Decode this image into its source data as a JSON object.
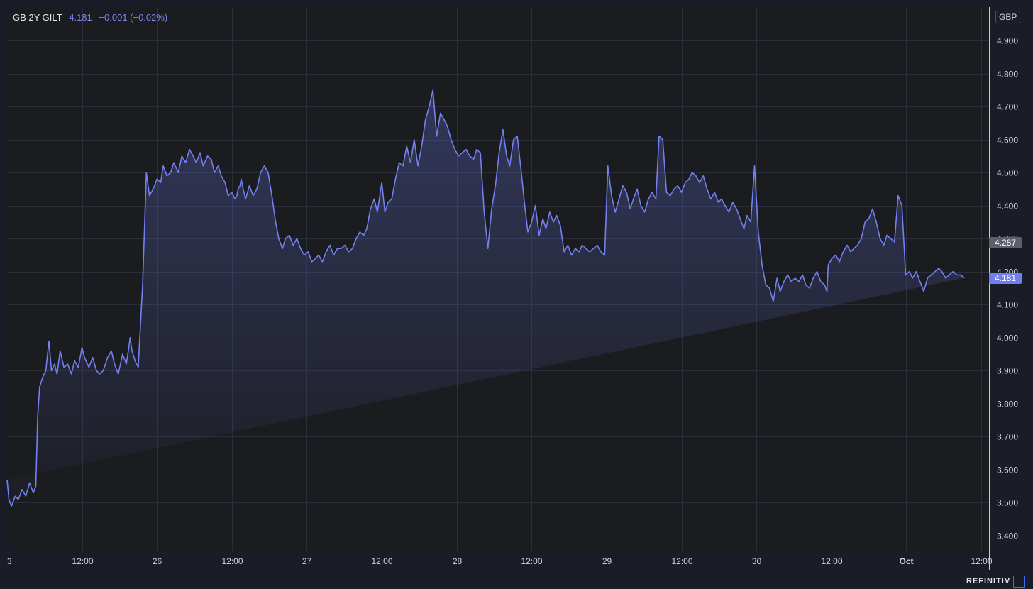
{
  "legend": {
    "symbol": "GB 2Y GILT",
    "last": "4.181",
    "change": "−0.001 (−0.02%)"
  },
  "currency": "GBP",
  "last_price_tag": "4.181",
  "prev_close_tag": "4.287",
  "brand": "REFINITIV",
  "colors": {
    "background": "#1a1d27",
    "plot_background": "#1b1c20",
    "line": "#7380f0",
    "grid": "#2a2e39",
    "axis_text": "#d1d4dc",
    "last_tag": "#6f7ef0",
    "prev_tag": "#5d606b"
  },
  "chart_data": {
    "type": "area",
    "title": "GB 2Y GILT",
    "xlabel": "",
    "ylabel": "",
    "ylim": [
      3.35,
      4.98
    ],
    "yticks": [
      3.4,
      3.5,
      3.6,
      3.7,
      3.8,
      3.9,
      4.0,
      4.1,
      4.2,
      4.3,
      4.4,
      4.5,
      4.6,
      4.7,
      4.8,
      4.9
    ],
    "ytick_labels": [
      "3.400",
      "3.500",
      "3.600",
      "3.700",
      "3.800",
      "3.900",
      "4.000",
      "4.100",
      "4.200",
      "4.300",
      "4.400",
      "4.500",
      "4.600",
      "4.700",
      "4.800",
      "4.900"
    ],
    "xlim": [
      0,
      132
    ],
    "xticks": [
      0,
      12,
      24,
      36,
      48,
      60,
      72,
      84,
      96,
      108,
      120,
      132
    ],
    "xtick_labels": [
      "3",
      "12:00",
      "26",
      "12:00",
      "27",
      "12:00",
      "28",
      "12:00",
      "29",
      "12:00",
      "30",
      "12:00",
      "Oct",
      "12:00"
    ],
    "xtick_hours": [
      0,
      12,
      24,
      36,
      48,
      60,
      72,
      84,
      96,
      108,
      120,
      132,
      144,
      156
    ],
    "x_hours_offset": -11.2,
    "grid": true,
    "legend_position": "top-left",
    "series": [
      {
        "name": "GB 2Y GILT",
        "hours": [
          -11.2,
          -10.9,
          -10.5,
          -9.9,
          -9.4,
          -8.8,
          -8.2,
          -7.6,
          -7.0,
          -6.6,
          -6.3,
          -6.0,
          -5.5,
          -5.0,
          -4.5,
          -4.1,
          -3.6,
          -3.2,
          -2.7,
          -2.1,
          -1.5,
          -0.9,
          -0.4,
          0.2,
          0.8,
          1.2,
          1.9,
          2.5,
          3.1,
          3.6,
          4.2,
          4.9,
          5.5,
          6.0,
          6.6,
          7.3,
          7.9,
          8.3,
          8.5,
          8.8,
          9.3,
          9.8,
          10.5,
          11.1,
          11.6,
          12.2,
          12.8,
          13.4,
          13.8,
          14.4,
          15.0,
          15.5,
          16.2,
          16.8,
          17.4,
          18.0,
          18.6,
          19.1,
          19.7,
          20.2,
          20.9,
          21.5,
          22.0,
          22.6,
          23.1,
          23.7,
          24.2,
          24.8,
          25.3,
          25.6,
          25.8,
          26.1,
          26.3,
          26.6,
          27.0,
          27.6,
          28.2,
          28.8,
          29.4,
          30.0,
          30.6,
          31.2,
          31.8,
          32.3,
          32.9,
          33.4,
          34.0,
          34.6,
          35.2,
          35.8,
          36.4,
          37.0,
          37.6,
          38.2,
          38.7,
          39.3,
          39.9,
          40.5,
          41.1,
          41.7,
          42.3,
          42.9,
          43.5,
          44.1,
          44.7,
          45.3,
          45.9,
          46.4,
          47.0,
          47.6,
          48.1,
          48.8,
          49.3,
          49.8,
          50.4,
          51.0,
          51.6,
          52.2,
          52.8,
          53.4,
          54.0,
          54.6,
          55.2,
          55.8,
          56.4,
          57.0,
          57.6,
          58.2,
          58.8,
          59.3,
          59.9,
          60.5,
          61.1,
          61.7,
          62.3,
          62.9,
          63.5,
          64.0,
          64.6,
          65.2,
          65.8,
          66.4,
          67.0,
          67.6,
          68.2,
          68.8,
          69.3,
          69.9,
          70.5,
          71.1,
          71.7,
          72.2,
          72.8,
          73.4,
          74.0,
          74.6,
          75.1,
          75.7,
          76.3,
          76.8,
          77.4,
          78.0,
          78.6,
          79.2,
          79.8,
          80.4,
          80.9,
          81.5,
          82.1,
          82.7,
          83.3,
          83.9,
          84.5,
          85.0,
          85.6,
          86.2,
          86.8,
          87.4,
          88.0,
          88.6,
          89.1,
          89.7,
          90.3,
          90.9,
          91.5,
          92.1,
          92.7,
          93.2,
          93.8,
          94.4,
          95.0,
          95.6,
          96.2,
          96.8,
          97.4,
          98.0,
          98.5,
          99.1,
          99.7,
          100.3,
          100.9,
          101.5,
          102.1,
          102.7,
          103.2,
          103.8,
          104.4,
          105.0,
          105.6,
          106.2,
          106.8,
          107.3,
          107.9,
          108.5,
          109.1,
          109.7,
          110.3,
          110.9,
          111.5,
          112.1,
          112.6,
          113.2,
          113.8,
          114.4,
          115.0,
          115.6,
          116.2,
          116.7,
          117.3,
          117.9,
          118.5,
          119.1,
          119.7,
          120.1,
          120.3,
          120.9,
          121.5,
          122.1,
          122.7,
          123.3,
          123.9,
          124.4,
          125.0,
          125.6,
          126.2,
          126.8,
          127.4,
          128.0,
          128.6,
          129.2,
          129.7,
          130.3,
          130.9,
          131.5,
          132.1,
          132.7,
          133.3,
          133.8,
          134.4,
          135.0,
          135.6,
          136.2,
          136.8,
          137.4,
          138.0,
          138.5,
          139.1,
          139.7,
          140.3,
          140.9,
          141.5,
          142.1,
          142.7,
          143.2,
          143.8,
          144.4,
          145.0,
          145.3,
          145.6,
          146.0,
          146.6,
          147.2,
          147.8,
          148.4,
          149.0,
          149.6,
          150.2,
          150.7,
          151.2
        ],
        "values": [
          3.57,
          3.51,
          3.49,
          3.52,
          3.51,
          3.54,
          3.52,
          3.56,
          3.53,
          3.55,
          3.76,
          3.85,
          3.88,
          3.9,
          3.99,
          3.9,
          3.92,
          3.89,
          3.96,
          3.91,
          3.92,
          3.89,
          3.93,
          3.91,
          3.97,
          3.94,
          3.91,
          3.94,
          3.9,
          3.89,
          3.9,
          3.94,
          3.96,
          3.92,
          3.89,
          3.95,
          3.92,
          3.97,
          4.0,
          3.96,
          3.93,
          3.91,
          4.16,
          4.5,
          4.43,
          4.45,
          4.48,
          4.47,
          4.52,
          4.49,
          4.5,
          4.53,
          4.5,
          4.55,
          4.53,
          4.57,
          4.55,
          4.53,
          4.56,
          4.52,
          4.55,
          4.54,
          4.5,
          4.52,
          4.49,
          4.47,
          4.43,
          4.44,
          4.42,
          4.43,
          4.45,
          4.46,
          4.48,
          4.45,
          4.42,
          4.46,
          4.43,
          4.45,
          4.5,
          4.52,
          4.5,
          4.43,
          4.35,
          4.3,
          4.27,
          4.3,
          4.31,
          4.28,
          4.3,
          4.27,
          4.25,
          4.26,
          4.23,
          4.24,
          4.25,
          4.23,
          4.26,
          4.28,
          4.25,
          4.27,
          4.27,
          4.28,
          4.26,
          4.27,
          4.3,
          4.32,
          4.31,
          4.33,
          4.39,
          4.42,
          4.38,
          4.47,
          4.38,
          4.41,
          4.42,
          4.48,
          4.53,
          4.52,
          4.58,
          4.53,
          4.6,
          4.52,
          4.58,
          4.66,
          4.7,
          4.75,
          4.61,
          4.68,
          4.66,
          4.64,
          4.6,
          4.57,
          4.55,
          4.56,
          4.57,
          4.55,
          4.54,
          4.57,
          4.56,
          4.38,
          4.27,
          4.39,
          4.46,
          4.56,
          4.63,
          4.55,
          4.52,
          4.6,
          4.61,
          4.51,
          4.4,
          4.32,
          4.35,
          4.4,
          4.31,
          4.36,
          4.33,
          4.38,
          4.35,
          4.37,
          4.34,
          4.26,
          4.28,
          4.25,
          4.27,
          4.26,
          4.28,
          4.27,
          4.26,
          4.27,
          4.28,
          4.26,
          4.25,
          4.52,
          4.43,
          4.38,
          4.42,
          4.46,
          4.44,
          4.39,
          4.42,
          4.45,
          4.4,
          4.38,
          4.42,
          4.44,
          4.42,
          4.61,
          4.6,
          4.44,
          4.43,
          4.45,
          4.46,
          4.44,
          4.47,
          4.48,
          4.5,
          4.49,
          4.47,
          4.49,
          4.45,
          4.42,
          4.44,
          4.41,
          4.42,
          4.4,
          4.38,
          4.41,
          4.39,
          4.36,
          4.33,
          4.37,
          4.35,
          4.52,
          4.32,
          4.22,
          4.16,
          4.15,
          4.11,
          4.18,
          4.14,
          4.17,
          4.19,
          4.17,
          4.18,
          4.17,
          4.19,
          4.16,
          4.15,
          4.18,
          4.2,
          4.17,
          4.16,
          4.14,
          4.22,
          4.24,
          4.25,
          4.23,
          4.26,
          4.28,
          4.26,
          4.27,
          4.28,
          4.3,
          4.35,
          4.36,
          4.39,
          4.35,
          4.3,
          4.28,
          4.31,
          4.3,
          4.29,
          4.43,
          4.4,
          4.19,
          4.2,
          4.18,
          4.2,
          4.17,
          4.14,
          4.18,
          4.19,
          4.2,
          4.21,
          4.2,
          4.18,
          4.19,
          4.2,
          4.19,
          4.19,
          4.181
        ]
      }
    ]
  }
}
